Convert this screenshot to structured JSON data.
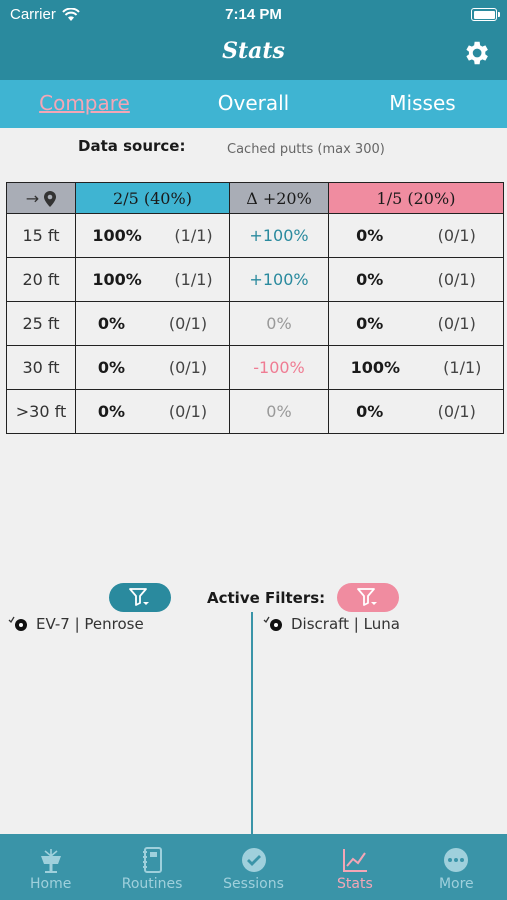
{
  "status_bar": {
    "carrier": "Carrier",
    "time": "7:14 PM"
  },
  "nav": {
    "title": "Stats",
    "settings_icon": "gear-icon"
  },
  "tabs": [
    {
      "label": "Compare",
      "active": true
    },
    {
      "label": "Overall",
      "active": false
    },
    {
      "label": "Misses",
      "active": false
    }
  ],
  "data_source": {
    "label": "Data source:",
    "value": "Cached putts (max 300)"
  },
  "table": {
    "header": {
      "icon": "arrow-location-icon",
      "icon_text": "→",
      "a": "2/5 (40%)",
      "delta": "Δ +20%",
      "b": "1/5 (20%)"
    },
    "rows": [
      {
        "distance": "15 ft",
        "a_pct": "100%",
        "a_frac": "(1/1)",
        "delta": "+100%",
        "delta_kind": "pos",
        "b_pct": "0%",
        "b_frac": "(0/1)"
      },
      {
        "distance": "20 ft",
        "a_pct": "100%",
        "a_frac": "(1/1)",
        "delta": "+100%",
        "delta_kind": "pos",
        "b_pct": "0%",
        "b_frac": "(0/1)"
      },
      {
        "distance": "25 ft",
        "a_pct": "0%",
        "a_frac": "(0/1)",
        "delta": "0%",
        "delta_kind": "zero",
        "b_pct": "0%",
        "b_frac": "(0/1)"
      },
      {
        "distance": "30 ft",
        "a_pct": "0%",
        "a_frac": "(0/1)",
        "delta": "-100%",
        "delta_kind": "neg",
        "b_pct": "100%",
        "b_frac": "(1/1)"
      },
      {
        "distance": ">30 ft",
        "a_pct": "0%",
        "a_frac": "(0/1)",
        "delta": "0%",
        "delta_kind": "zero",
        "b_pct": "0%",
        "b_frac": "(0/1)"
      }
    ]
  },
  "filters": {
    "label": "Active Filters:",
    "disc_a": "EV-7 | Penrose",
    "disc_b": "Discraft | Luna"
  },
  "tabbar": [
    {
      "label": "Home",
      "icon": "basket-icon",
      "active": false
    },
    {
      "label": "Routines",
      "icon": "notebook-icon",
      "active": false
    },
    {
      "label": "Sessions",
      "icon": "check-circle-icon",
      "active": false
    },
    {
      "label": "Stats",
      "icon": "chart-icon",
      "active": true
    },
    {
      "label": "More",
      "icon": "ellipsis-icon",
      "active": false
    }
  ],
  "colors": {
    "primary": "#2a8a9e",
    "accent_blue": "#3fb4d2",
    "accent_pink": "#f08ca0",
    "header_gray": "#a9adb6"
  }
}
